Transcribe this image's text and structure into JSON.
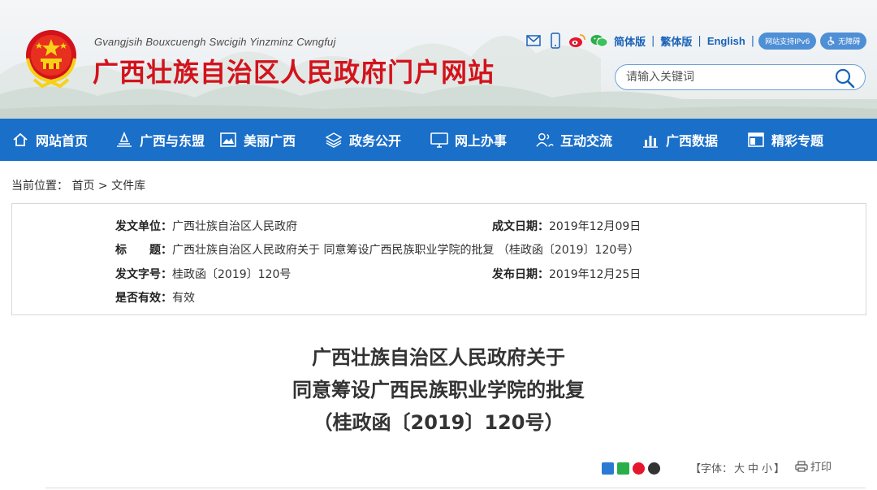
{
  "header": {
    "pinyin": "Gvangjsih Bouxcuengh Swcigih Yinzminz Cwngfuj",
    "title": "广西壮族自治区人民政府门户网站",
    "links": {
      "simplified": "简体版",
      "traditional": "繁体版",
      "english": "English",
      "separator": "|",
      "ipv6": "网站支持IPv6",
      "accessibility": "无障碍"
    },
    "icons": [
      "mail-icon",
      "mobile-icon",
      "weibo-icon",
      "wechat-icon"
    ],
    "search": {
      "placeholder": "请输入关键词"
    }
  },
  "nav": {
    "items": [
      {
        "label": "网站首页",
        "icon": "home-icon"
      },
      {
        "label": "广西与东盟",
        "icon": "asean-icon"
      },
      {
        "label": "美丽广西",
        "icon": "picture-icon"
      },
      {
        "label": "政务公开",
        "icon": "layers-icon"
      },
      {
        "label": "网上办事",
        "icon": "monitor-icon"
      },
      {
        "label": "互动交流",
        "icon": "users-icon"
      },
      {
        "label": "广西数据",
        "icon": "chart-icon"
      },
      {
        "label": "精彩专题",
        "icon": "topic-icon"
      }
    ]
  },
  "breadcrumb": {
    "prefix": "当前位置：",
    "home": "首页",
    "separator": ">",
    "current": "文件库"
  },
  "info": {
    "issuer_label": "发文单位：",
    "issuer": "广西壮族自治区人民政府",
    "created_label": "成文日期：",
    "created": "2019年12月09日",
    "title_label": "标　　题：",
    "title": "广西壮族自治区人民政府关于 同意筹设广西民族职业学院的批复 （桂政函〔2019〕120号）",
    "doc_no_label": "发文字号：",
    "doc_no": "桂政函〔2019〕120号",
    "published_label": "发布日期：",
    "published": "2019年12月25日",
    "valid_label": "是否有效：",
    "valid": "有效"
  },
  "document": {
    "title_line1": "广西壮族自治区人民政府关于",
    "title_line2": "同意筹设广西民族职业学院的批复",
    "title_line3": "（桂政函〔2019〕120号）"
  },
  "toolbar": {
    "font_prefix": "【字体：",
    "font_large": "大",
    "font_medium": "中",
    "font_small": "小",
    "font_suffix": "】",
    "print": "打印"
  },
  "colors": {
    "brand_red": "#d3121b",
    "nav_blue": "#1a6fc9",
    "link_blue": "#1a62b8"
  }
}
